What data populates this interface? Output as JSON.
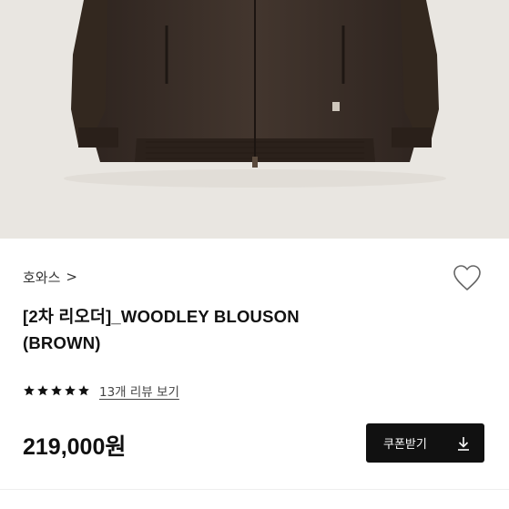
{
  "product_image": {
    "alt_icon": "jacket-photo"
  },
  "brand": {
    "name": "호와스",
    "chevron": ">"
  },
  "product": {
    "title_line1": "[2차 리오더]_WOODLEY BLOUSON",
    "title_line2": "(BROWN)",
    "price": "219,000원"
  },
  "rating": {
    "stars": 5,
    "max_stars": 5,
    "review_link": "13개 리뷰 보기",
    "star_color": "#111111"
  },
  "coupon_button": {
    "label": "쿠폰받기",
    "icon": "download-icon"
  },
  "colors": {
    "button_bg": "#111111",
    "hero_bg": "#e9e6e1",
    "jacket": "#3b3029"
  }
}
